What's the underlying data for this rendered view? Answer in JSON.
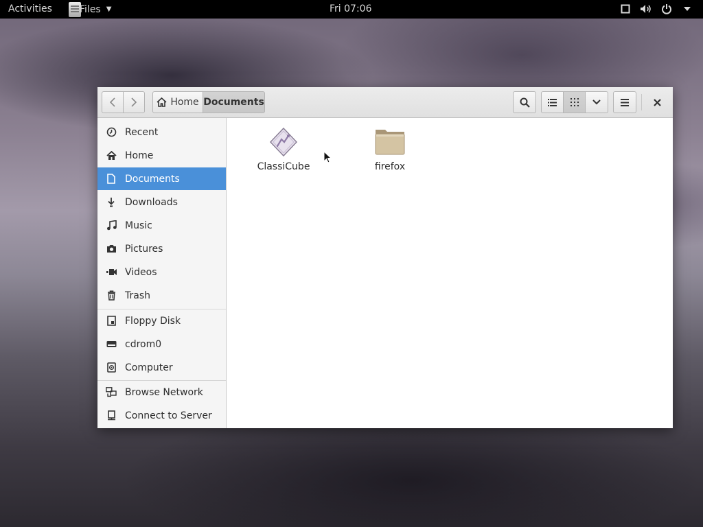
{
  "topbar": {
    "activities": "Activities",
    "app_label": "Files",
    "clock": "Fri 07:06",
    "icons": [
      "window-icon",
      "volume-icon",
      "power-icon",
      "chevron-down-icon"
    ]
  },
  "window": {
    "path": {
      "home": "Home",
      "current": "Documents"
    },
    "sidebar": {
      "places": [
        {
          "label": "Recent",
          "icon": "clock-icon"
        },
        {
          "label": "Home",
          "icon": "home-icon"
        },
        {
          "label": "Documents",
          "icon": "document-icon",
          "active": true
        },
        {
          "label": "Downloads",
          "icon": "download-icon"
        },
        {
          "label": "Music",
          "icon": "music-icon"
        },
        {
          "label": "Pictures",
          "icon": "camera-icon"
        },
        {
          "label": "Videos",
          "icon": "video-icon"
        },
        {
          "label": "Trash",
          "icon": "trash-icon"
        }
      ],
      "devices": [
        {
          "label": "Floppy Disk",
          "icon": "floppy-icon"
        },
        {
          "label": "cdrom0",
          "icon": "drive-icon"
        },
        {
          "label": "Computer",
          "icon": "computer-icon"
        }
      ],
      "network": [
        {
          "label": "Browse Network",
          "icon": "network-icon"
        },
        {
          "label": "Connect to Server",
          "icon": "server-icon"
        }
      ]
    },
    "files": [
      {
        "name": "ClassiCube",
        "icon": "executable-icon"
      },
      {
        "name": "firefox",
        "icon": "folder-icon"
      }
    ]
  },
  "colors": {
    "selection": "#4a90d9",
    "topbar": "#000000",
    "folder": "#c9b48d"
  }
}
